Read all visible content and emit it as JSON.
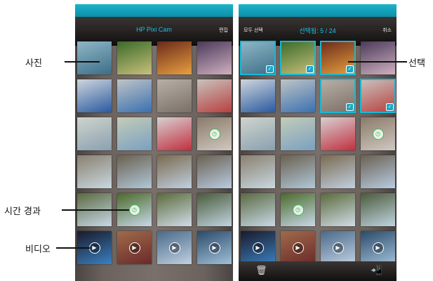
{
  "callouts": {
    "photo": "사진",
    "timelapse": "시간 경과",
    "video": "비디오",
    "select": "선택"
  },
  "left_screen": {
    "title": "HP Pixi Cam",
    "edit_label": "편집"
  },
  "right_screen": {
    "select_all_label": "모두 선택",
    "selected_count": "선택됨: 5 / 24",
    "cancel_label": "취소",
    "delete_icon": "trash-icon",
    "share_icon": "phone-share-icon"
  },
  "thumbnails": [
    {
      "kind": "photo",
      "colors": [
        "#8fb7c8",
        "#3d6e86"
      ]
    },
    {
      "kind": "photo",
      "colors": [
        "#3a6a2a",
        "#c9c07a"
      ]
    },
    {
      "kind": "photo",
      "colors": [
        "#6b2a1a",
        "#e8a040"
      ]
    },
    {
      "kind": "photo",
      "colors": [
        "#4a3a5a",
        "#d0b0c0"
      ]
    },
    {
      "kind": "photo",
      "colors": [
        "#cfd6dc",
        "#2a5aa0"
      ]
    },
    {
      "kind": "photo",
      "colors": [
        "#c0c4c6",
        "#3a70b0"
      ]
    },
    {
      "kind": "photo",
      "colors": [
        "#b8b0a8",
        "#7a6f66"
      ]
    },
    {
      "kind": "photo",
      "colors": [
        "#c8c2bc",
        "#b84040"
      ]
    },
    {
      "kind": "photo",
      "colors": [
        "#cfd4cc",
        "#8aa0b0"
      ]
    },
    {
      "kind": "photo",
      "colors": [
        "#c4ccb8",
        "#7aa0c0"
      ]
    },
    {
      "kind": "photo",
      "colors": [
        "#d8d0d0",
        "#c03040"
      ]
    },
    {
      "kind": "timelapse",
      "colors": [
        "#8a7a6a",
        "#d0c8c0"
      ]
    },
    {
      "kind": "photo",
      "colors": [
        "#8a8070",
        "#c8d8e0"
      ]
    },
    {
      "kind": "photo",
      "colors": [
        "#6a6050",
        "#b0c8d8"
      ]
    },
    {
      "kind": "photo",
      "colors": [
        "#7a6a50",
        "#c0d0e0"
      ]
    },
    {
      "kind": "photo",
      "colors": [
        "#6a6052",
        "#b8cce0"
      ]
    },
    {
      "kind": "photo",
      "colors": [
        "#5a6a40",
        "#c8d8e8"
      ]
    },
    {
      "kind": "timelapse",
      "colors": [
        "#4a6a2a",
        "#c8d8e8"
      ]
    },
    {
      "kind": "photo",
      "colors": [
        "#5a6a3a",
        "#d0dce8"
      ]
    },
    {
      "kind": "photo",
      "colors": [
        "#4a5a3a",
        "#c0d4e0"
      ]
    },
    {
      "kind": "video",
      "colors": [
        "#1a1a2a",
        "#3a80c0"
      ]
    },
    {
      "kind": "video",
      "colors": [
        "#a06a4a",
        "#6a2a2a"
      ]
    },
    {
      "kind": "video",
      "colors": [
        "#4a6a8a",
        "#c0d0e0"
      ]
    },
    {
      "kind": "video",
      "colors": [
        "#2a4a6a",
        "#a0c0d8"
      ]
    }
  ],
  "selected_indices": [
    0,
    1,
    2,
    6,
    7
  ]
}
